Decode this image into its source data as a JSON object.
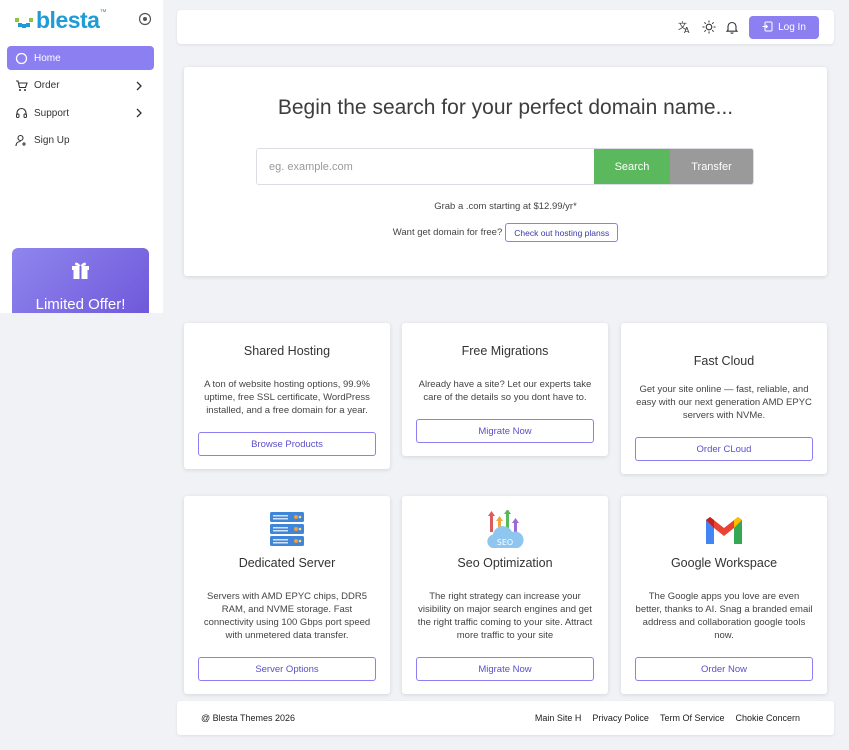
{
  "brand": {
    "name": "blesta",
    "tm": "™"
  },
  "sidebar": {
    "items": [
      {
        "label": "Home",
        "icon": "circle-icon",
        "active": true
      },
      {
        "label": "Order",
        "icon": "cart-icon",
        "has_children": true
      },
      {
        "label": "Support",
        "icon": "headset-icon",
        "has_children": true
      },
      {
        "label": "Sign Up",
        "icon": "user-plus-icon"
      }
    ],
    "offer": {
      "title": "Limited Offer!",
      "icon": "gift-icon"
    }
  },
  "topbar": {
    "icons": [
      "translate-icon",
      "sun-icon",
      "bell-icon"
    ],
    "login_label": "Log In"
  },
  "search": {
    "title": "Begin the search for your perfect domain name...",
    "placeholder": "eg. example.com",
    "search_label": "Search",
    "transfer_label": "Transfer",
    "promo": "Grab a .com starting at $12.99/yr*",
    "free_text": "Want get domain for free?",
    "free_button": "Check out hosting planss"
  },
  "cards": [
    {
      "title": "Shared Hosting",
      "desc": "A ton of website hosting options, 99.9% uptime, free SSL certificate, WordPress installed, and a free domain for a year.",
      "button": "Browse Products"
    },
    {
      "title": "Free Migrations",
      "desc": "Already have a site? Let our experts take care of the details so you dont have to.",
      "button": "Migrate Now"
    },
    {
      "title": "Fast Cloud",
      "desc": "Get your site online — fast, reliable, and easy with our next generation AMD EPYC servers with NVMe.",
      "button": "Order CLoud"
    },
    {
      "title": "Dedicated Server",
      "desc": "Servers with AMD EPYC chips, DDR5 RAM, and NVME storage. Fast connectivity using 100 Gbps port speed with unmetered data transfer.",
      "button": "Server Options",
      "icon": "server-icon"
    },
    {
      "title": "Seo Optimization",
      "desc": "The right strategy can increase your visibility on major search engines and get the right traffic coming to your site. Attract more traffic to your site",
      "button": "Migrate Now",
      "icon": "seo-cloud-icon",
      "icon_text": "SEO"
    },
    {
      "title": "Google Workspace",
      "desc": "The Google apps you love are even better, thanks to AI. Snag a branded email address and collaboration google tools now.",
      "button": "Order Now",
      "icon": "gmail-icon"
    }
  ],
  "footer": {
    "copyright": "@ Blesta Themes 2026",
    "links": [
      "Main Site H",
      "Privacy Police",
      "Term Of Service",
      "Chokie Concern"
    ]
  },
  "colors": {
    "accent": "#8c7ff2",
    "search": "#5cb85c",
    "transfer": "#9a9a9a",
    "brand": "#1f9bd6"
  }
}
